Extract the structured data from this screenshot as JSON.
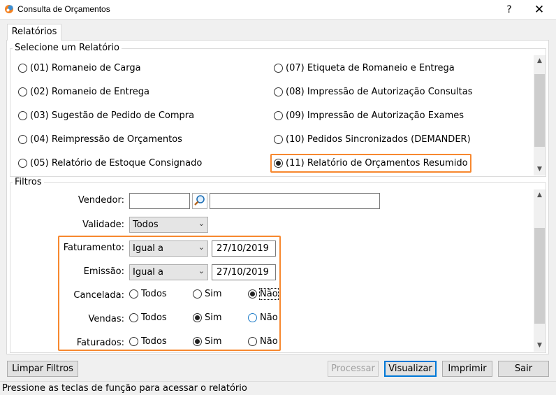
{
  "window": {
    "title": "Consulta de Orçamentos",
    "help": "?",
    "close": "✕"
  },
  "tabs": [
    {
      "label": "Relatórios"
    }
  ],
  "reports": {
    "title": "Selecione um Relatório",
    "items": [
      {
        "label": "(01) Romaneio de Carga",
        "checked": false
      },
      {
        "label": "(02) Romaneio de Entrega",
        "checked": false
      },
      {
        "label": "(03) Sugestão de Pedido de Compra",
        "checked": false
      },
      {
        "label": "(04) Reimpressão de Orçamentos",
        "checked": false
      },
      {
        "label": "(05) Relatório de Estoque Consignado",
        "checked": false
      },
      {
        "label": "(07) Etiqueta de Romaneio e Entrega",
        "checked": false
      },
      {
        "label": "(08) Impressão de Autorização Consultas",
        "checked": false
      },
      {
        "label": "(09) Impressão de Autorização Exames",
        "checked": false
      },
      {
        "label": "(10) Pedidos Sincronizados (DEMANDER)",
        "checked": false
      },
      {
        "label": "(11) Relatório de Orçamentos Resumido",
        "checked": true
      }
    ]
  },
  "filters": {
    "title": "Filtros",
    "vendedor": {
      "label": "Vendedor:",
      "code": "",
      "name": ""
    },
    "validade": {
      "label": "Validade:",
      "value": "Todos"
    },
    "faturamento": {
      "label": "Faturamento:",
      "operator": "Igual a",
      "date": "27/10/2019"
    },
    "emissao": {
      "label": "Emissão:",
      "operator": "Igual a",
      "date": "27/10/2019"
    },
    "cancelada": {
      "label": "Cancelada:",
      "options": [
        "Todos",
        "Sim",
        "Não"
      ],
      "selected": "Não"
    },
    "vendas": {
      "label": "Vendas:",
      "options": [
        "Todos",
        "Sim",
        "Não"
      ],
      "selected": "Sim"
    },
    "faturados": {
      "label": "Faturados:",
      "options": [
        "Todos",
        "Sim",
        "Não"
      ],
      "selected": "Sim"
    }
  },
  "buttons": {
    "limpar": "Limpar Filtros",
    "processar": "Processar",
    "visualizar": "Visualizar",
    "imprimir": "Imprimir",
    "sair": "Sair"
  },
  "status": "Pressione as teclas de função para acessar o relatório",
  "colors": {
    "highlight": "#f7882f",
    "focus": "#0078d7"
  }
}
